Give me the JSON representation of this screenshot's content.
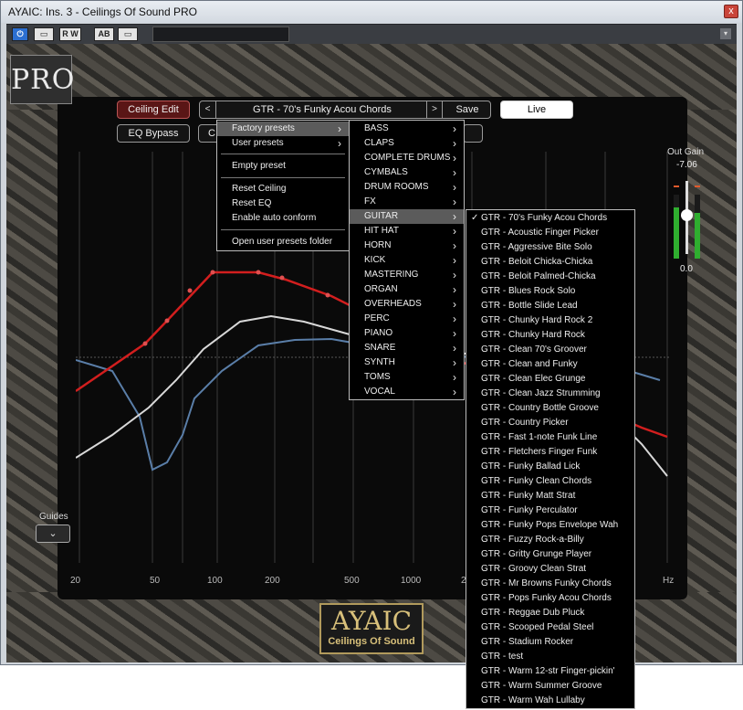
{
  "window": {
    "title": "AYAIC: Ins. 3 - Ceilings Of Sound PRO",
    "close_label": "x"
  },
  "toolbar": {
    "buttons": [
      "⏻",
      "▭",
      "R W",
      "AB",
      "▭"
    ],
    "dropdown_symbol": "▾"
  },
  "plugin": {
    "logo_text": "PRO",
    "ceiling_edit": "Ceiling Edit",
    "eq_bypass": "EQ Bypass",
    "preset_prev": "<",
    "preset_next": ">",
    "preset_name": "GTR - 70's Funky Acou Chords",
    "save": "Save",
    "live": "Live",
    "hidden_btn_a": "C",
    "hidden_btn_b": "",
    "out_gain_title": "Out Gain",
    "out_gain_value": "-7.06",
    "out_gain_zero": "0.0",
    "guides_label": "Guides",
    "guides_chevron": "⌄",
    "freq_labels": [
      "20",
      "50",
      "100",
      "200",
      "500",
      "1000",
      "2",
      "Hz"
    ],
    "brand_title": "AYAIC",
    "brand_subtitle": "Ceilings Of Sound",
    "meters": {
      "left_level": 0.8,
      "right_level": 0.72
    }
  },
  "menus": {
    "main": {
      "items": [
        "Factory presets",
        "User presets",
        "Empty preset",
        "Reset Ceiling",
        "Reset EQ",
        "Enable auto conform",
        "Open user presets folder"
      ],
      "highlighted": "Factory presets"
    },
    "categories": {
      "items": [
        "BASS",
        "CLAPS",
        "COMPLETE DRUMS",
        "CYMBALS",
        "DRUM ROOMS",
        "FX",
        "GUITAR",
        "HIT HAT",
        "HORN",
        "KICK",
        "MASTERING",
        "ORGAN",
        "OVERHEADS",
        "PERC",
        "PIANO",
        "SNARE",
        "SYNTH",
        "TOMS",
        "VOCAL"
      ],
      "highlighted": "GUITAR"
    },
    "guitar": {
      "checked": "GTR - 70's Funky Acou Chords",
      "items": [
        "GTR - 70's Funky Acou Chords",
        "GTR - Acoustic Finger Picker",
        "GTR - Aggressive Bite Solo",
        "GTR - Beloit Chicka-Chicka",
        "GTR - Beloit Palmed-Chicka",
        "GTR - Blues Rock Solo",
        "GTR - Bottle Slide Lead",
        "GTR - Chunky Hard Rock 2",
        "GTR - Chunky Hard Rock",
        "GTR - Clean 70's Groover",
        "GTR - Clean and Funky",
        "GTR - Clean Elec Grunge",
        "GTR - Clean Jazz Strumming",
        "GTR - Country Bottle Groove",
        "GTR - Country Picker",
        "GTR - Fast 1-note Funk Line",
        "GTR - Fletchers Finger Funk",
        "GTR - Funky Ballad Lick",
        "GTR - Funky Clean Chords",
        "GTR - Funky Matt Strat",
        "GTR - Funky Perculator",
        "GTR - Funky Pops Envelope Wah",
        "GTR - Fuzzy Rock-a-Billy",
        "GTR - Gritty Grunge Player",
        "GTR - Groovy Clean Strat",
        "GTR - Mr Browns Funky Chords",
        "GTR - Pops Funky Acou Chords",
        "GTR - Reggae Dub Pluck",
        "GTR - Scooped Pedal Steel",
        "GTR - Stadium Rocker",
        "GTR - test",
        "GTR - Warm 12-str Finger-pickin'",
        "GTR - Warm Summer Groove",
        "GTR - Warm Wah Lullaby"
      ]
    },
    "check_mark": "✓",
    "submenu_arrow": "›"
  },
  "colors": {
    "ceiling_curve": "#d21e1e",
    "eq_curve": "#d8d8d8",
    "band_curve": "#5a7ea8",
    "brand_gold": "#d8c07a"
  }
}
